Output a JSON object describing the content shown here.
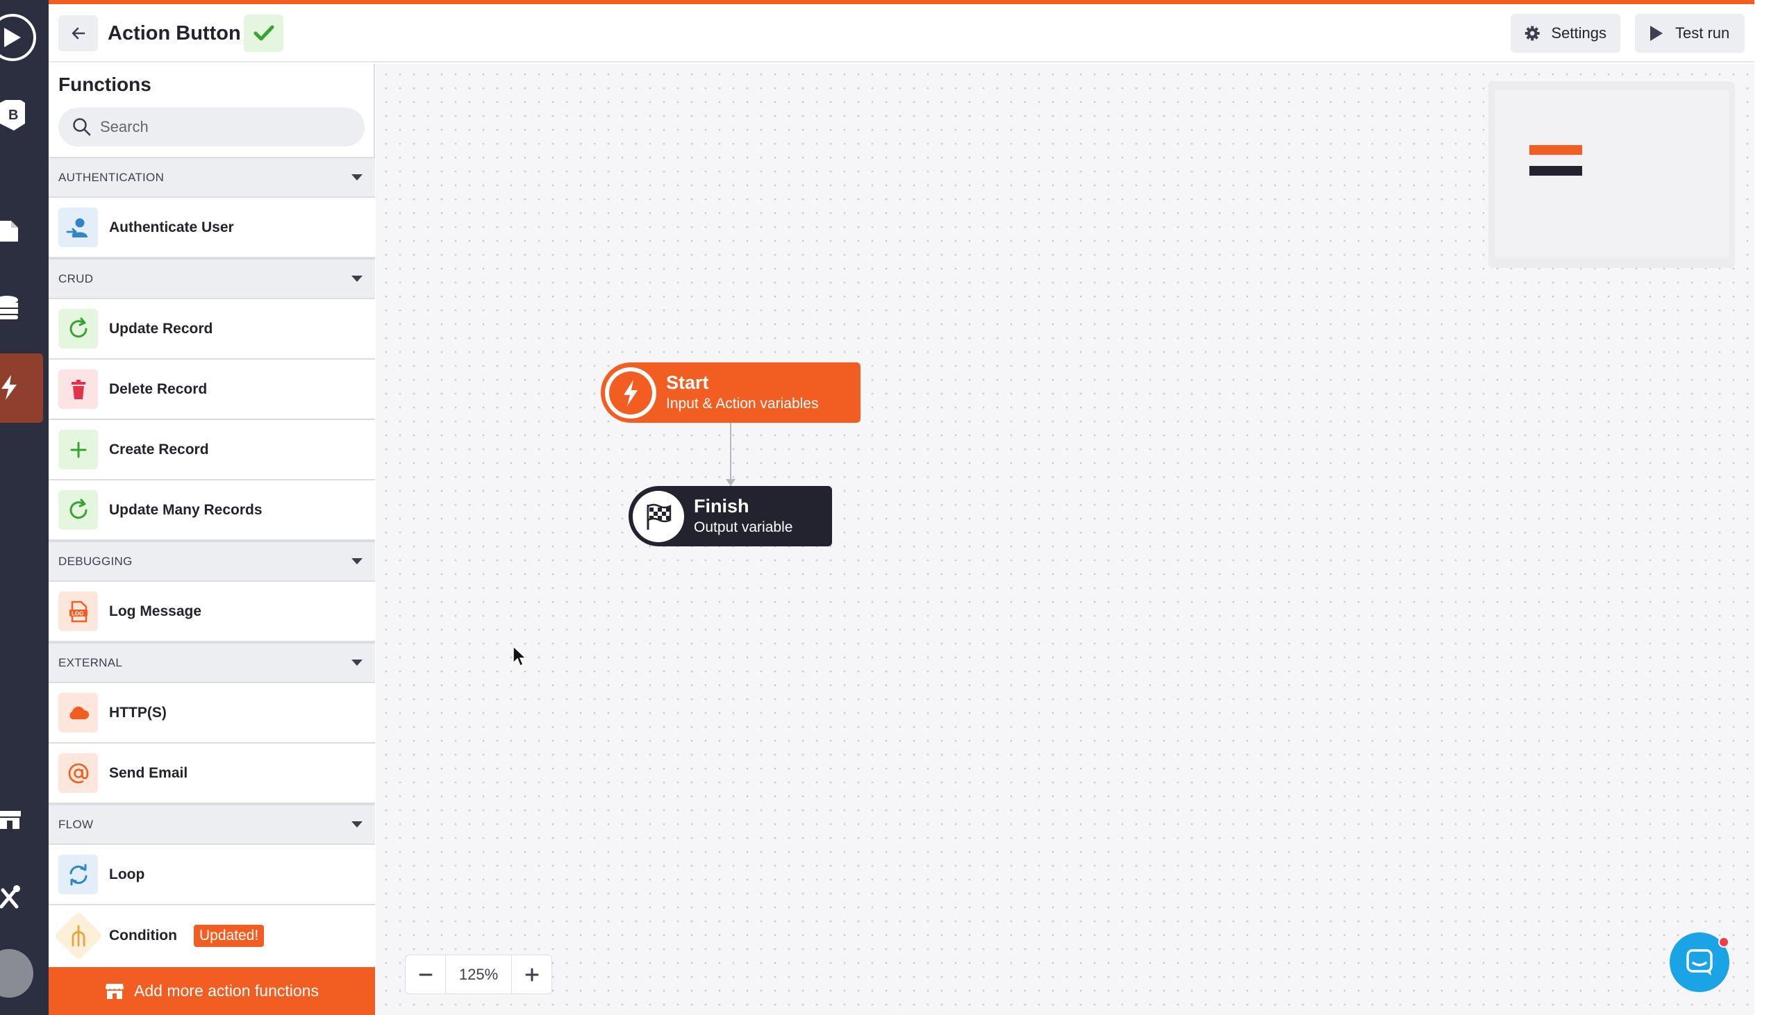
{
  "header": {
    "title": "Action Button",
    "settings_label": "Settings",
    "test_run_label": "Test run"
  },
  "rail": {
    "icons": [
      "play-logo-icon",
      "bold-b-icon",
      "page-icon",
      "database-icon",
      "lightning-icon",
      "store-icon",
      "tools-icon",
      "avatar"
    ],
    "active": "lightning-icon"
  },
  "sidebar": {
    "title": "Functions",
    "search_placeholder": "Search",
    "sections": [
      {
        "label": "AUTHENTICATION",
        "items": [
          {
            "label": "Authenticate User",
            "icon": "user-arrow-icon"
          }
        ]
      },
      {
        "label": "CRUD",
        "items": [
          {
            "label": "Update Record",
            "icon": "refresh-icon"
          },
          {
            "label": "Delete Record",
            "icon": "trash-icon"
          },
          {
            "label": "Create Record",
            "icon": "plus-icon"
          },
          {
            "label": "Update Many Records",
            "icon": "refresh-icon"
          }
        ]
      },
      {
        "label": "DEBUGGING",
        "items": [
          {
            "label": "Log Message",
            "icon": "log-icon"
          }
        ]
      },
      {
        "label": "EXTERNAL",
        "items": [
          {
            "label": "HTTP(S)",
            "icon": "cloud-icon"
          },
          {
            "label": "Send Email",
            "icon": "at-icon"
          }
        ]
      },
      {
        "label": "FLOW",
        "items": [
          {
            "label": "Loop",
            "icon": "loop-icon"
          },
          {
            "label": "Condition",
            "icon": "condition-icon",
            "badge": "Updated!"
          }
        ]
      }
    ],
    "add_more_label": "Add more action functions"
  },
  "canvas": {
    "start_node": {
      "title": "Start",
      "subtitle": "Input & Action variables"
    },
    "finish_node": {
      "title": "Finish",
      "subtitle": "Output variable"
    },
    "zoom_level": "125%"
  },
  "colors": {
    "accent": "#f25d22",
    "rail": "#2c2f3f",
    "dark_node": "#23232f",
    "chat": "#1aa4e6"
  }
}
